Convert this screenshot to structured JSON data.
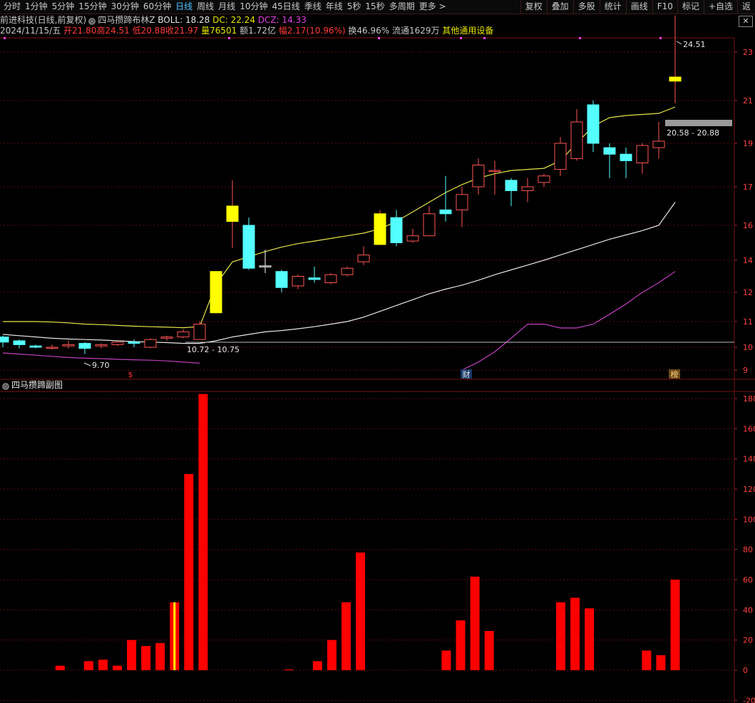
{
  "toolbar": {
    "periods": [
      "分时",
      "1分钟",
      "5分钟",
      "15分钟",
      "30分钟",
      "60分钟",
      "日线",
      "周线",
      "月线",
      "10分钟",
      "45日线",
      "季线",
      "年线",
      "5秒",
      "15秒",
      "多周期",
      "更多 >"
    ],
    "active_period": "日线",
    "tools": [
      "复权",
      "叠加",
      "多股",
      "统计",
      "画线",
      "F10",
      "标记",
      "+自选",
      "返"
    ]
  },
  "header": {
    "stock_name": "前进科技(日线,前复权)",
    "indicator_name": "四马攒蹄布林Z",
    "boll": "BOLL: 18.28",
    "dc": "DC: 22.24",
    "dcz": "DCZ: 14.33"
  },
  "quote": {
    "date": "2024/11/15/五",
    "open": "开21.80",
    "high": "高24.51",
    "low": "低20.88",
    "close": "收21.97",
    "volume": "量76501",
    "amount": "额1.72亿",
    "change": "幅2.17(10.96%)",
    "turnover": "换46.96%",
    "float": "流通1629万",
    "industry": "其他通用设备"
  },
  "close_button": "✕",
  "main_chart": {
    "price_axis": [
      "23",
      "21",
      "19",
      "17",
      "16",
      "14",
      "12",
      "11",
      "10",
      "9"
    ],
    "annotation_high": "24.51",
    "annotation_low": "9.70",
    "annotation_range1": "10.72 - 10.75",
    "annotation_range2": "20.58 - 20.88",
    "badge_s": "$",
    "badge_cai": "财",
    "badge_bang": "榜"
  },
  "sub_chart": {
    "title": "四马攒蹄副图",
    "axis": [
      "180",
      "160",
      "140",
      "120",
      "100",
      "80",
      "60",
      "40",
      "20",
      "0",
      "-20"
    ]
  },
  "colors": {
    "up": "#ff5555",
    "down": "#54ffff",
    "yellow": "#ffff00",
    "boll_upper": "#e6e64a",
    "boll_mid": "#e6e6e6",
    "boll_lower": "#c040c0",
    "bar": "#ff0000"
  },
  "chart_data": {
    "type": "candlestick",
    "candles": [
      {
        "o": 10.2,
        "c": 10.4,
        "h": 10.45,
        "l": 10.0,
        "k": "down"
      },
      {
        "o": 10.25,
        "c": 10.1,
        "h": 10.3,
        "l": 9.95,
        "k": "down"
      },
      {
        "o": 10.05,
        "c": 10.0,
        "h": 10.1,
        "l": 9.95,
        "k": "down"
      },
      {
        "o": 10.0,
        "c": 10.0,
        "h": 10.1,
        "l": 9.9,
        "k": "up"
      },
      {
        "o": 10.05,
        "c": 10.1,
        "h": 10.25,
        "l": 9.95,
        "k": "up"
      },
      {
        "o": 10.15,
        "c": 9.95,
        "h": 10.2,
        "l": 9.7,
        "k": "down"
      },
      {
        "o": 10.05,
        "c": 10.1,
        "h": 10.15,
        "l": 9.95,
        "k": "up"
      },
      {
        "o": 10.1,
        "c": 10.2,
        "h": 10.25,
        "l": 10.05,
        "k": "up"
      },
      {
        "o": 10.15,
        "c": 10.2,
        "h": 10.3,
        "l": 10.0,
        "k": "down"
      },
      {
        "o": 10.0,
        "c": 10.3,
        "h": 10.35,
        "l": 9.95,
        "k": "up"
      },
      {
        "o": 10.35,
        "c": 10.4,
        "h": 10.45,
        "l": 10.25,
        "k": "up"
      },
      {
        "o": 10.4,
        "c": 10.6,
        "h": 10.7,
        "l": 10.35,
        "k": "up"
      },
      {
        "o": 10.3,
        "c": 10.9,
        "h": 11.0,
        "l": 10.3,
        "k": "up"
      },
      {
        "o": 11.3,
        "c": 13.3,
        "h": 13.3,
        "l": 11.3,
        "k": "yellow"
      },
      {
        "o": 16.1,
        "c": 16.5,
        "h": 17.3,
        "l": 14.7,
        "k": "yellow"
      },
      {
        "o": 16.0,
        "c": 13.5,
        "h": 16.2,
        "l": 13.4,
        "k": "down"
      },
      {
        "o": 13.65,
        "c": 13.65,
        "h": 14.6,
        "l": 13.2,
        "k": "flat"
      },
      {
        "o": 13.3,
        "c": 12.3,
        "h": 13.4,
        "l": 12.0,
        "k": "down"
      },
      {
        "o": 12.4,
        "c": 13.0,
        "h": 13.1,
        "l": 12.2,
        "k": "up"
      },
      {
        "o": 12.9,
        "c": 12.8,
        "h": 13.6,
        "l": 12.6,
        "k": "down"
      },
      {
        "o": 12.6,
        "c": 13.1,
        "h": 13.2,
        "l": 12.5,
        "k": "up"
      },
      {
        "o": 13.1,
        "c": 13.5,
        "h": 13.6,
        "l": 13.0,
        "k": "up"
      },
      {
        "o": 13.9,
        "c": 14.3,
        "h": 14.8,
        "l": 13.7,
        "k": "up"
      },
      {
        "o": 14.9,
        "c": 16.3,
        "h": 16.4,
        "l": 14.9,
        "k": "yellow"
      },
      {
        "o": 16.2,
        "c": 15.0,
        "h": 16.4,
        "l": 14.8,
        "k": "down"
      },
      {
        "o": 15.1,
        "c": 15.4,
        "h": 15.8,
        "l": 15.0,
        "k": "up"
      },
      {
        "o": 15.4,
        "c": 16.3,
        "h": 16.5,
        "l": 15.4,
        "k": "up"
      },
      {
        "o": 16.4,
        "c": 16.3,
        "h": 17.5,
        "l": 16.1,
        "k": "down"
      },
      {
        "o": 16.4,
        "c": 16.8,
        "h": 17.0,
        "l": 15.9,
        "k": "up"
      },
      {
        "o": 17.0,
        "c": 18.0,
        "h": 18.3,
        "l": 16.8,
        "k": "up"
      },
      {
        "o": 17.7,
        "c": 17.75,
        "h": 18.2,
        "l": 16.8,
        "k": "up"
      },
      {
        "o": 17.3,
        "c": 16.9,
        "h": 17.4,
        "l": 16.5,
        "k": "down"
      },
      {
        "o": 16.9,
        "c": 17.0,
        "h": 17.4,
        "l": 16.6,
        "k": "up"
      },
      {
        "o": 17.2,
        "c": 17.5,
        "h": 17.6,
        "l": 17.0,
        "k": "up"
      },
      {
        "o": 17.8,
        "c": 19.0,
        "h": 19.3,
        "l": 17.5,
        "k": "up"
      },
      {
        "o": 18.3,
        "c": 20.0,
        "h": 20.6,
        "l": 18.2,
        "k": "up"
      },
      {
        "o": 20.8,
        "c": 19.0,
        "h": 21.0,
        "l": 18.6,
        "k": "down"
      },
      {
        "o": 18.8,
        "c": 18.5,
        "h": 19.0,
        "l": 17.4,
        "k": "down"
      },
      {
        "o": 18.5,
        "c": 18.2,
        "h": 18.8,
        "l": 17.4,
        "k": "down"
      },
      {
        "o": 18.1,
        "c": 18.9,
        "h": 19.0,
        "l": 17.6,
        "k": "up"
      },
      {
        "o": 18.8,
        "c": 19.1,
        "h": 20.0,
        "l": 18.3,
        "k": "up"
      },
      {
        "o": 21.8,
        "c": 21.97,
        "h": 24.51,
        "l": 20.88,
        "k": "yellow"
      }
    ],
    "boll_upper": [
      11.0,
      11.0,
      11.0,
      10.98,
      10.95,
      10.9,
      10.88,
      10.85,
      10.82,
      10.8,
      10.78,
      10.76,
      10.8,
      12.5,
      13.9,
      14.2,
      14.5,
      14.75,
      14.95,
      15.1,
      15.25,
      15.4,
      15.55,
      15.8,
      16.1,
      16.35,
      16.6,
      16.85,
      17.1,
      17.4,
      17.6,
      17.75,
      17.8,
      17.85,
      18.2,
      19.0,
      19.8,
      20.2,
      20.3,
      20.35,
      20.4,
      20.7
    ],
    "boll_mid": [
      10.5,
      10.45,
      10.4,
      10.35,
      10.32,
      10.3,
      10.28,
      10.25,
      10.22,
      10.2,
      10.18,
      10.15,
      10.15,
      10.25,
      10.4,
      10.5,
      10.6,
      10.65,
      10.72,
      10.8,
      10.9,
      11.0,
      11.15,
      11.35,
      11.55,
      11.75,
      11.95,
      12.2,
      12.45,
      12.75,
      13.1,
      13.4,
      13.7,
      14.0,
      14.3,
      14.6,
      14.9,
      15.2,
      15.45,
      15.7,
      16.0,
      16.6
    ],
    "boll_lower": [
      9.75,
      9.7,
      9.65,
      9.6,
      9.55,
      9.52,
      9.5,
      9.47,
      9.45,
      9.43,
      9.4,
      9.35,
      9.3,
      null,
      null,
      null,
      null,
      null,
      null,
      null,
      null,
      null,
      null,
      null,
      null,
      null,
      null,
      null,
      9.0,
      9.35,
      9.8,
      10.35,
      10.9,
      10.9,
      10.75,
      10.75,
      10.9,
      11.25,
      11.6,
      12.0,
      12.6,
      13.3
    ],
    "sub_values": [
      0,
      0,
      0,
      0,
      3,
      0,
      6,
      7,
      3,
      20,
      16,
      18,
      45,
      130,
      183,
      0,
      0,
      0,
      0,
      0,
      0.5,
      0,
      6,
      20,
      45,
      78,
      0,
      0,
      0,
      0,
      0,
      13,
      33,
      62,
      26,
      0,
      0,
      0,
      0,
      45,
      48,
      41,
      0,
      0,
      0,
      13,
      10,
      60
    ]
  }
}
